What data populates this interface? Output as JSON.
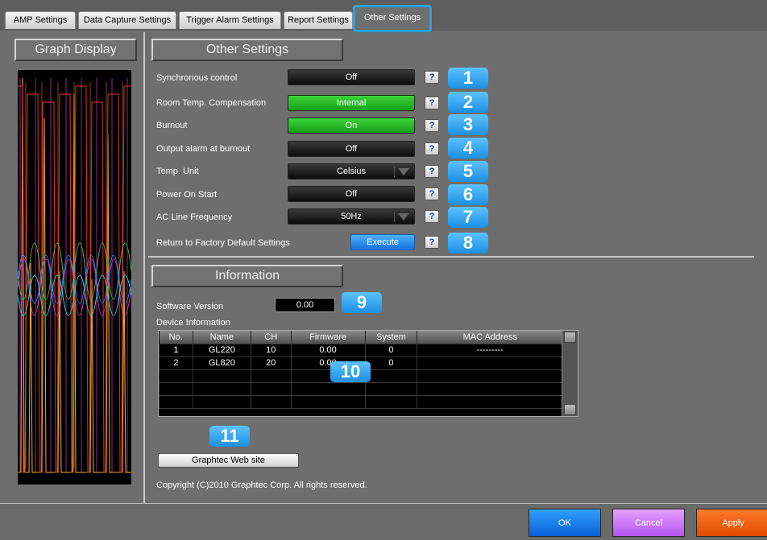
{
  "tabs": [
    {
      "label": "AMP Settings"
    },
    {
      "label": "Data Capture Settings"
    },
    {
      "label": "Trigger Alarm Settings"
    },
    {
      "label": "Report Settings"
    },
    {
      "label": "Other Settings",
      "active": true
    }
  ],
  "left_panel": {
    "title": "Graph Display"
  },
  "other_settings": {
    "title": "Other Settings",
    "rows": [
      {
        "label": "Synchronous control",
        "value": "Off",
        "type": "toggle",
        "badge": "1"
      },
      {
        "label": "Room Temp. Compensation",
        "value": "Internal",
        "type": "toggle",
        "active": true,
        "badge": "2"
      },
      {
        "label": "Burnout",
        "value": "On",
        "type": "toggle",
        "active": true,
        "badge": "3"
      },
      {
        "label": "Output alarm at burnout",
        "value": "Off",
        "type": "toggle",
        "badge": "4"
      },
      {
        "label": "Temp. Unit",
        "value": "Celsius",
        "type": "dropdown",
        "badge": "5"
      },
      {
        "label": "Power On Start",
        "value": "Off",
        "type": "toggle",
        "badge": "6"
      },
      {
        "label": "AC Line Frequency",
        "value": "50Hz",
        "type": "dropdown",
        "badge": "7"
      },
      {
        "label": "Return to Factory Default Settings",
        "value": "Execute",
        "type": "button",
        "badge": "8"
      }
    ],
    "help_label": "?"
  },
  "information": {
    "title": "Information",
    "software_version_label": "Software Version",
    "software_version": "0.00",
    "software_badge": "9",
    "device_info_label": "Device Information",
    "table_badge": "10",
    "columns": [
      "No.",
      "Name",
      "CH",
      "Firmware",
      "System",
      "MAC Address"
    ],
    "rows": [
      [
        "1",
        "GL220",
        "10",
        "0.00",
        "0",
        "---------"
      ],
      [
        "2",
        "GL820",
        "20",
        "0.00",
        "0",
        ""
      ],
      [
        "",
        "",
        "",
        "",
        "",
        ""
      ],
      [
        "",
        "",
        "",
        "",
        "",
        ""
      ],
      [
        "",
        "",
        "",
        "",
        "",
        ""
      ]
    ],
    "website_badge": "11",
    "website_button": "Graphtec Web site",
    "copyright": "Copyright (C)2010 Graphtec Corp. All rights reserved."
  },
  "footer": {
    "ok": "OK",
    "cancel": "Cancel",
    "apply": "Apply"
  },
  "colors": {
    "accent_blue": "#2aa0e8",
    "active_green": "#22b522",
    "ok_blue": "#1a7ff0",
    "cancel_purple": "#c97af5",
    "apply_orange": "#f25d10"
  }
}
